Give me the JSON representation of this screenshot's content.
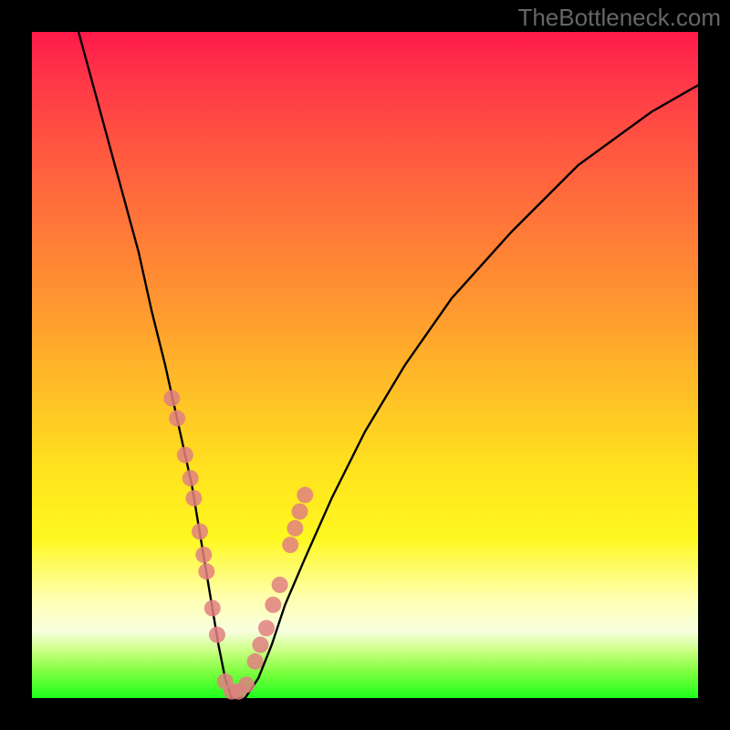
{
  "watermark": "TheBottleneck.com",
  "chart_data": {
    "type": "line",
    "title": "",
    "xlabel": "",
    "ylabel": "",
    "xlim": [
      0,
      100
    ],
    "ylim": [
      0,
      100
    ],
    "series": [
      {
        "name": "curve",
        "x": [
          7,
          10,
          13,
          16,
          18,
          20,
          22,
          24,
          25,
          26,
          27,
          28,
          29,
          30,
          31,
          32,
          34,
          36,
          38,
          41,
          45,
          50,
          56,
          63,
          72,
          82,
          93,
          100
        ],
        "y": [
          100,
          89,
          78,
          67,
          58,
          50,
          41,
          32,
          26,
          20,
          14,
          8,
          3,
          0,
          0,
          0,
          3,
          8,
          14,
          21,
          30,
          40,
          50,
          60,
          70,
          80,
          88,
          92
        ]
      }
    ],
    "points": {
      "name": "markers",
      "x": [
        21.0,
        21.8,
        23.0,
        23.8,
        24.3,
        25.2,
        25.8,
        26.2,
        27.1,
        27.8,
        29.0,
        30.0,
        31.0,
        32.2,
        33.5,
        34.3,
        35.2,
        36.2,
        37.2,
        38.8,
        39.5,
        40.2,
        41.0
      ],
      "y": [
        45.0,
        42.0,
        36.5,
        33.0,
        30.0,
        25.0,
        21.5,
        19.0,
        13.5,
        9.5,
        2.5,
        1.0,
        1.0,
        2.0,
        5.5,
        8.0,
        10.5,
        14.0,
        17.0,
        23.0,
        25.5,
        28.0,
        30.5
      ]
    },
    "gradient_stops": [
      {
        "pos": 0,
        "color": "#ff1a4a"
      },
      {
        "pos": 18,
        "color": "#ff5840"
      },
      {
        "pos": 42,
        "color": "#ff9a2f"
      },
      {
        "pos": 66,
        "color": "#ffe31e"
      },
      {
        "pos": 90,
        "color": "#f8ffdf"
      },
      {
        "pos": 100,
        "color": "#1dff1d"
      }
    ]
  }
}
